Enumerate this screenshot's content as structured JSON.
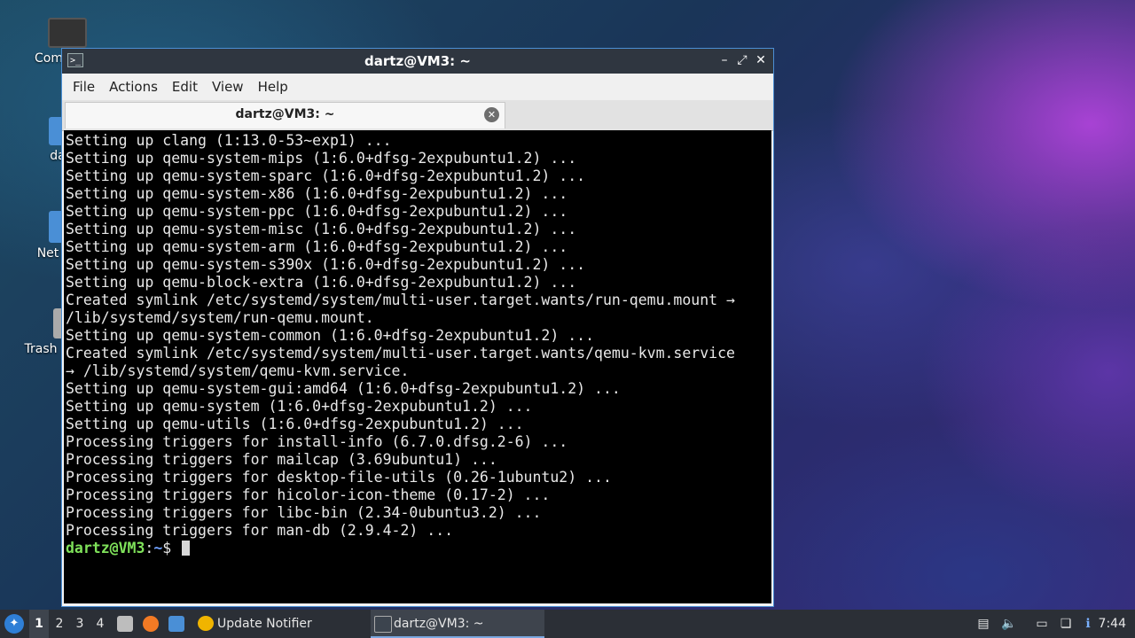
{
  "desktop": {
    "icons": [
      {
        "label": "Com",
        "icon": "computer-icon"
      },
      {
        "label": "da",
        "icon": "folder-icon"
      },
      {
        "label": "Net",
        "icon": "network-icon"
      },
      {
        "label": "Trash",
        "icon": "trash-icon"
      }
    ]
  },
  "window": {
    "title": "dartz@VM3: ~",
    "controls": {
      "minimize": "–",
      "maximize": "⤢",
      "close": "✕"
    },
    "menu": [
      "File",
      "Actions",
      "Edit",
      "View",
      "Help"
    ],
    "tab": {
      "label": "dartz@VM3: ~",
      "close": "✕"
    }
  },
  "terminal": {
    "lines": [
      "Setting up clang (1:13.0-53~exp1) ...",
      "Setting up qemu-system-mips (1:6.0+dfsg-2expubuntu1.2) ...",
      "Setting up qemu-system-sparc (1:6.0+dfsg-2expubuntu1.2) ...",
      "Setting up qemu-system-x86 (1:6.0+dfsg-2expubuntu1.2) ...",
      "Setting up qemu-system-ppc (1:6.0+dfsg-2expubuntu1.2) ...",
      "Setting up qemu-system-misc (1:6.0+dfsg-2expubuntu1.2) ...",
      "Setting up qemu-system-arm (1:6.0+dfsg-2expubuntu1.2) ...",
      "Setting up qemu-system-s390x (1:6.0+dfsg-2expubuntu1.2) ...",
      "Setting up qemu-block-extra (1:6.0+dfsg-2expubuntu1.2) ...",
      "Created symlink /etc/systemd/system/multi-user.target.wants/run-qemu.mount →",
      "/lib/systemd/system/run-qemu.mount.",
      "Setting up qemu-system-common (1:6.0+dfsg-2expubuntu1.2) ...",
      "Created symlink /etc/systemd/system/multi-user.target.wants/qemu-kvm.service",
      "→ /lib/systemd/system/qemu-kvm.service.",
      "Setting up qemu-system-gui:amd64 (1:6.0+dfsg-2expubuntu1.2) ...",
      "Setting up qemu-system (1:6.0+dfsg-2expubuntu1.2) ...",
      "Setting up qemu-utils (1:6.0+dfsg-2expubuntu1.2) ...",
      "Processing triggers for install-info (6.7.0.dfsg.2-6) ...",
      "Processing triggers for mailcap (3.69ubuntu1) ...",
      "Processing triggers for desktop-file-utils (0.26-1ubuntu2) ...",
      "Processing triggers for hicolor-icon-theme (0.17-2) ...",
      "Processing triggers for libc-bin (2.34-0ubuntu3.2) ...",
      "Processing triggers for man-db (2.9.4-2) ..."
    ],
    "prompt_user": "dartz@VM3",
    "prompt_sep": ":",
    "prompt_path": "~",
    "prompt_symbol": "$ "
  },
  "taskbar": {
    "workspaces": [
      "1",
      "2",
      "3",
      "4"
    ],
    "active_workspace": "1",
    "tasks": [
      {
        "label": "Update Notifier",
        "icon": "update-notifier-icon"
      },
      {
        "label": "dartz@VM3: ~",
        "icon": "terminal-icon"
      }
    ],
    "clock": "7:44"
  },
  "colors": {
    "accent": "#4b8fd4",
    "prompt_user": "#7fe25a",
    "prompt_path": "#6fa0ff"
  }
}
